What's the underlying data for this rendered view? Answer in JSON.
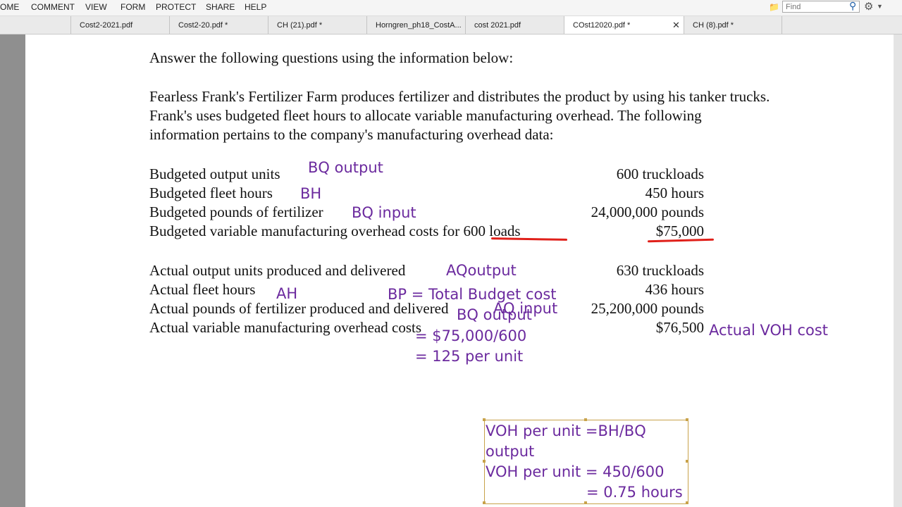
{
  "menu": [
    "OME",
    "COMMENT",
    "VIEW",
    "FORM",
    "PROTECT",
    "SHARE",
    "HELP"
  ],
  "search": {
    "placeholder": "Find"
  },
  "icons": {
    "find_folder": "folder-search-icon",
    "search": "magnifier-icon",
    "settings": "gear-icon",
    "close": "close-icon"
  },
  "tabs": [
    {
      "label": "Cost2-2021.pdf"
    },
    {
      "label": "Cost2-20.pdf *"
    },
    {
      "label": "CH (21).pdf *"
    },
    {
      "label": "Horngren_ph18_CostA..."
    },
    {
      "label": "cost 2021.pdf"
    },
    {
      "label": "COst12020.pdf *"
    },
    {
      "label": "CH (8).pdf *"
    }
  ],
  "document": {
    "intro": "Answer the following questions using the information below:",
    "para": [
      "Fearless Frank's Fertilizer Farm produces fertilizer and distributes the product by using his tanker trucks.",
      "Frank's uses budgeted fleet hours to allocate variable manufacturing overhead. The following",
      "information pertains to the company's manufacturing overhead data:"
    ],
    "rows": [
      {
        "label": "Budgeted output units",
        "value": "600 truckloads"
      },
      {
        "label": "Budgeted fleet hours",
        "value": "450 hours"
      },
      {
        "label": "Budgeted pounds of fertilizer",
        "value": "24,000,000 pounds"
      },
      {
        "label": "Budgeted variable manufacturing overhead costs for 600 loads",
        "value": "$75,000"
      },
      {
        "label": "Actual output units produced and delivered",
        "value": "630 truckloads"
      },
      {
        "label": "Actual fleet hours",
        "value": "436 hours"
      },
      {
        "label": "Actual pounds of fertilizer produced and delivered",
        "value": "25,200,000 pounds"
      },
      {
        "label": "Actual variable manufacturing overhead costs",
        "value": "$76,500"
      }
    ]
  },
  "annotations": {
    "bq_output": "BQ output",
    "bh": "BH",
    "bq_input": "BQ input",
    "aq_output": "AQoutput",
    "ah": "AH",
    "bp_total": "BP = Total Budget cost",
    "aq_input": "AQ input",
    "bq_output2": "BQ output",
    "bp_calc": "= $75,000/600",
    "bp_result": "=  125 per unit",
    "actual_voh": "Actual VOH cost",
    "box_line1": "VOH per unit =BH/BQ",
    "box_line2": "output",
    "box_line3": "VOH per unit = 450/600",
    "box_line4": "= 0.75 hours"
  }
}
